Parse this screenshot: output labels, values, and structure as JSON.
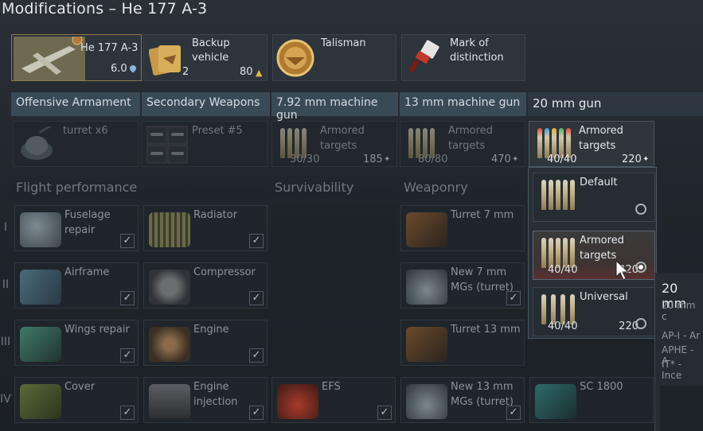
{
  "window": {
    "title": "Modifications – He 177 A-3"
  },
  "top_cards": {
    "aircraft": {
      "name": "He 177 A-3",
      "br": "6.0"
    },
    "backup": {
      "label": "Backup vehicle",
      "count": "2",
      "cost": "80"
    },
    "talisman": {
      "label": "Talisman"
    },
    "mark": {
      "label": "Mark of distinction"
    }
  },
  "columns": [
    "Offensive Armament",
    "Secondary Weapons",
    "7.92 mm machine gun",
    "13 mm machine gun",
    "20 mm gun"
  ],
  "weapon_slots": {
    "offensive": {
      "label": "turret x6"
    },
    "secondary": {
      "label": "Preset #5"
    },
    "mg792": {
      "label": "Armored targets",
      "count": "30/30",
      "price": "185"
    },
    "mg13": {
      "label": "Armored targets",
      "count": "80/80",
      "price": "470"
    },
    "gun20": {
      "label": "Armored targets",
      "count": "40/40",
      "price": "220"
    }
  },
  "sections": {
    "flight": "Flight performance",
    "survivability": "Survivability",
    "weaponry": "Weaponry"
  },
  "tiers": [
    "I",
    "II",
    "III",
    "IV"
  ],
  "mods": {
    "fuselage": "Fuselage repair",
    "radiator": "Radiator",
    "turret7": "Turret 7 mm",
    "airframe": "Airframe",
    "compressor": "Compressor",
    "new7": "New 7 mm MGs (turret)",
    "wings": "Wings repair",
    "engine": "Engine",
    "turret13": "Turret 13 mm",
    "cover": "Cover",
    "injection": "Engine injection",
    "efs": "EFS",
    "new13": "New 13 mm MGs (turret)",
    "sc1800": "SC 1800"
  },
  "dropdown": {
    "options": [
      {
        "label": "Default",
        "count": "",
        "price": ""
      },
      {
        "label": "Armored targets",
        "count": "40/40",
        "price": "220"
      },
      {
        "label": "Universal",
        "count": "40/40",
        "price": "220"
      }
    ]
  },
  "tooltip": {
    "title": "20 mm",
    "lines": [
      "20 mm c",
      "AP-I - Ar",
      "APHE - A",
      "IT* - Ince"
    ]
  },
  "colors": {
    "accent": "#7f9cb5",
    "header_bg": "#3c4e5c",
    "selected_glow": "#6a2f2f"
  }
}
